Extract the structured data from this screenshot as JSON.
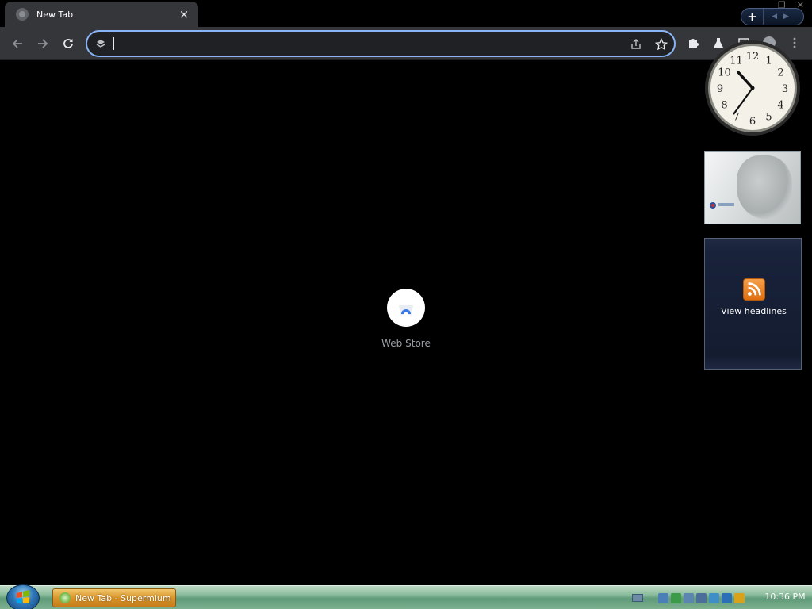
{
  "browser": {
    "tab": {
      "title": "New Tab",
      "close_glyph": "×",
      "favicon": "globe-icon"
    },
    "omnibox": {
      "value": "",
      "placeholder": "",
      "search_icon": "google-lens-icon"
    },
    "toolbar_icons": [
      "back-arrow-icon",
      "forward-arrow-icon",
      "reload-icon",
      "share-icon",
      "star-icon",
      "puzzle-icon",
      "flask-icon",
      "sidepanel-icon",
      "profile-icon",
      "more-vert-icon"
    ],
    "accent": "#8ab4f8"
  },
  "ntp": {
    "shortcut": {
      "label": "Web Store",
      "icon": "chrome-web-store-icon"
    }
  },
  "gadgets": {
    "toolbar": {
      "add_label": "+"
    },
    "clock": {
      "hour": 10,
      "minute": 36,
      "numerals": [
        "12",
        "1",
        "2",
        "3",
        "4",
        "5",
        "6",
        "7",
        "8",
        "9",
        "10",
        "11"
      ]
    },
    "slideshow": {
      "icon": "slideshow-image"
    },
    "headlines": {
      "label": "View headlines",
      "icon": "rss-icon"
    }
  },
  "taskbar": {
    "start_icon": "windows-orb-icon",
    "task": {
      "label": "New Tab - Supermium",
      "icon": "supermium-icon"
    },
    "time": "10:36 PM",
    "tray_colors": [
      "#4a7fb8",
      "#3d9a4a",
      "#5c86b0",
      "#4c6e9a",
      "#3f8ec8",
      "#2c6fb6",
      "#d9a21b"
    ]
  }
}
